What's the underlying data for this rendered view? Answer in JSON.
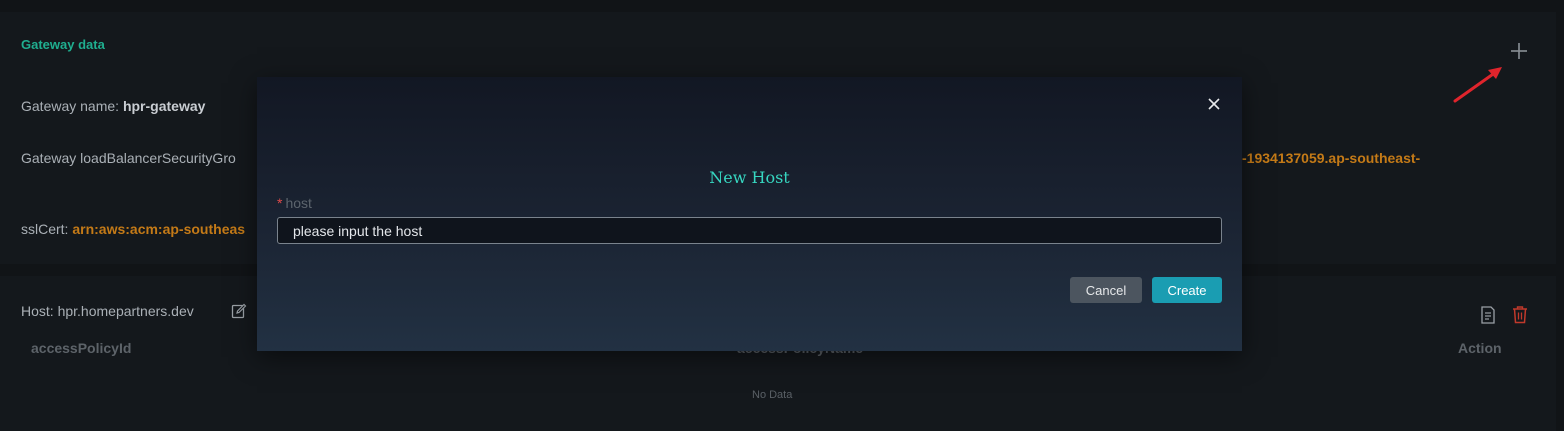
{
  "gateway": {
    "section_title": "Gateway data",
    "name_label": "Gateway name: ",
    "name_value": "hpr-gateway",
    "lb_label": "Gateway loadBalancerSecurityGro",
    "lb_value_tail": "-1934137059.ap-southeast-",
    "ssl_label": "sslCert: ",
    "ssl_value": "arn:aws:acm:ap-southeas"
  },
  "host_card": {
    "host_text": "Host: hpr.homepartners.dev",
    "columns": [
      "accessPolicyId",
      "accessPolicyName",
      "Action"
    ],
    "empty_text": "No Data"
  },
  "modal": {
    "title": "New Host",
    "field_label": "host",
    "input_value": "please input the host",
    "cancel_label": "Cancel",
    "create_label": "Create"
  },
  "colors": {
    "accent_teal": "#1fae8f",
    "value_orange": "#c47a17",
    "annotation_red": "#e0242c",
    "create_button": "#1a9db2",
    "delete_icon": "#c0392b"
  },
  "icons": [
    "plus-icon",
    "close-icon",
    "edit-icon",
    "document-icon",
    "trash-icon",
    "red-arrow-annotation"
  ]
}
